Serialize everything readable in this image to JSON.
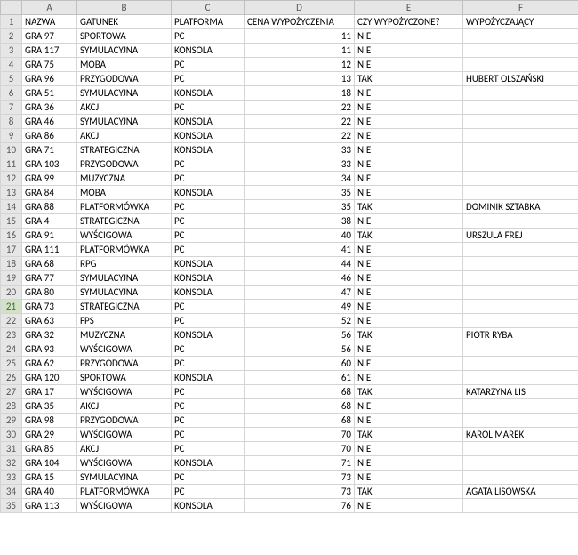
{
  "columns": [
    "A",
    "B",
    "C",
    "D",
    "E",
    "F"
  ],
  "selectedRow": 21,
  "headers": {
    "A": "NAZWA",
    "B": "GATUNEK",
    "C": "PLATFORMA",
    "D": "CENA WYPOŻYCZENIA",
    "E": "CZY WYPOŻYCZONE?",
    "F": "WYPOŻYCZAJĄCY"
  },
  "rows": [
    {
      "A": "GRA 97",
      "B": "SPORTOWA",
      "C": "PC",
      "D": 11,
      "E": "NIE",
      "F": ""
    },
    {
      "A": "GRA 117",
      "B": "SYMULACYJNA",
      "C": "KONSOLA",
      "D": 11,
      "E": "NIE",
      "F": ""
    },
    {
      "A": "GRA 75",
      "B": "MOBA",
      "C": "PC",
      "D": 12,
      "E": "NIE",
      "F": ""
    },
    {
      "A": "GRA 96",
      "B": "PRZYGODOWA",
      "C": "PC",
      "D": 13,
      "E": "TAK",
      "F": "HUBERT OLSZAŃSKI"
    },
    {
      "A": "GRA 51",
      "B": "SYMULACYJNA",
      "C": "KONSOLA",
      "D": 18,
      "E": "NIE",
      "F": ""
    },
    {
      "A": "GRA 36",
      "B": "AKCJI",
      "C": "PC",
      "D": 22,
      "E": "NIE",
      "F": ""
    },
    {
      "A": "GRA 46",
      "B": "SYMULACYJNA",
      "C": "KONSOLA",
      "D": 22,
      "E": "NIE",
      "F": ""
    },
    {
      "A": "GRA 86",
      "B": "AKCJI",
      "C": "KONSOLA",
      "D": 22,
      "E": "NIE",
      "F": ""
    },
    {
      "A": "GRA 71",
      "B": "STRATEGICZNA",
      "C": "KONSOLA",
      "D": 33,
      "E": "NIE",
      "F": ""
    },
    {
      "A": "GRA 103",
      "B": "PRZYGODOWA",
      "C": "PC",
      "D": 33,
      "E": "NIE",
      "F": ""
    },
    {
      "A": "GRA 99",
      "B": "MUZYCZNA",
      "C": "PC",
      "D": 34,
      "E": "NIE",
      "F": ""
    },
    {
      "A": "GRA 84",
      "B": "MOBA",
      "C": "KONSOLA",
      "D": 35,
      "E": "NIE",
      "F": ""
    },
    {
      "A": "GRA 88",
      "B": "PLATFORMÓWKA",
      "C": "PC",
      "D": 35,
      "E": "TAK",
      "F": "DOMINIK SZTABKA"
    },
    {
      "A": "GRA 4",
      "B": "STRATEGICZNA",
      "C": "PC",
      "D": 38,
      "E": "NIE",
      "F": ""
    },
    {
      "A": "GRA 91",
      "B": "WYŚCIGOWA",
      "C": "PC",
      "D": 40,
      "E": "TAK",
      "F": "URSZULA FREJ"
    },
    {
      "A": "GRA 111",
      "B": "PLATFORMÓWKA",
      "C": "PC",
      "D": 41,
      "E": "NIE",
      "F": ""
    },
    {
      "A": "GRA 68",
      "B": "RPG",
      "C": "KONSOLA",
      "D": 44,
      "E": "NIE",
      "F": ""
    },
    {
      "A": "GRA 77",
      "B": "SYMULACYJNA",
      "C": "KONSOLA",
      "D": 46,
      "E": "NIE",
      "F": ""
    },
    {
      "A": "GRA 80",
      "B": "SYMULACYJNA",
      "C": "KONSOLA",
      "D": 47,
      "E": "NIE",
      "F": ""
    },
    {
      "A": "GRA 73",
      "B": "STRATEGICZNA",
      "C": "PC",
      "D": 49,
      "E": "NIE",
      "F": ""
    },
    {
      "A": "GRA 63",
      "B": "FPS",
      "C": "PC",
      "D": 52,
      "E": "NIE",
      "F": ""
    },
    {
      "A": "GRA 32",
      "B": "MUZYCZNA",
      "C": "KONSOLA",
      "D": 56,
      "E": "TAK",
      "F": "PIOTR RYBA"
    },
    {
      "A": "GRA 93",
      "B": "WYŚCIGOWA",
      "C": "PC",
      "D": 56,
      "E": "NIE",
      "F": ""
    },
    {
      "A": "GRA 62",
      "B": "PRZYGODOWA",
      "C": "PC",
      "D": 60,
      "E": "NIE",
      "F": ""
    },
    {
      "A": "GRA 120",
      "B": "SPORTOWA",
      "C": "KONSOLA",
      "D": 61,
      "E": "NIE",
      "F": ""
    },
    {
      "A": "GRA 17",
      "B": "WYŚCIGOWA",
      "C": "PC",
      "D": 68,
      "E": "TAK",
      "F": "KATARZYNA LIS"
    },
    {
      "A": "GRA 35",
      "B": "AKCJI",
      "C": "PC",
      "D": 68,
      "E": "NIE",
      "F": ""
    },
    {
      "A": "GRA 98",
      "B": "PRZYGODOWA",
      "C": "PC",
      "D": 68,
      "E": "NIE",
      "F": ""
    },
    {
      "A": "GRA 29",
      "B": "WYŚCIGOWA",
      "C": "PC",
      "D": 70,
      "E": "TAK",
      "F": "KAROL MAREK"
    },
    {
      "A": "GRA 85",
      "B": "AKCJI",
      "C": "PC",
      "D": 70,
      "E": "NIE",
      "F": ""
    },
    {
      "A": "GRA 104",
      "B": "WYŚCIGOWA",
      "C": "KONSOLA",
      "D": 71,
      "E": "NIE",
      "F": ""
    },
    {
      "A": "GRA 15",
      "B": "SYMULACYJNA",
      "C": "PC",
      "D": 73,
      "E": "NIE",
      "F": ""
    },
    {
      "A": "GRA 40",
      "B": "PLATFORMÓWKA",
      "C": "PC",
      "D": 73,
      "E": "TAK",
      "F": "AGATA LISOWSKA"
    },
    {
      "A": "GRA 113",
      "B": "WYŚCIGOWA",
      "C": "KONSOLA",
      "D": 76,
      "E": "NIE",
      "F": ""
    }
  ]
}
